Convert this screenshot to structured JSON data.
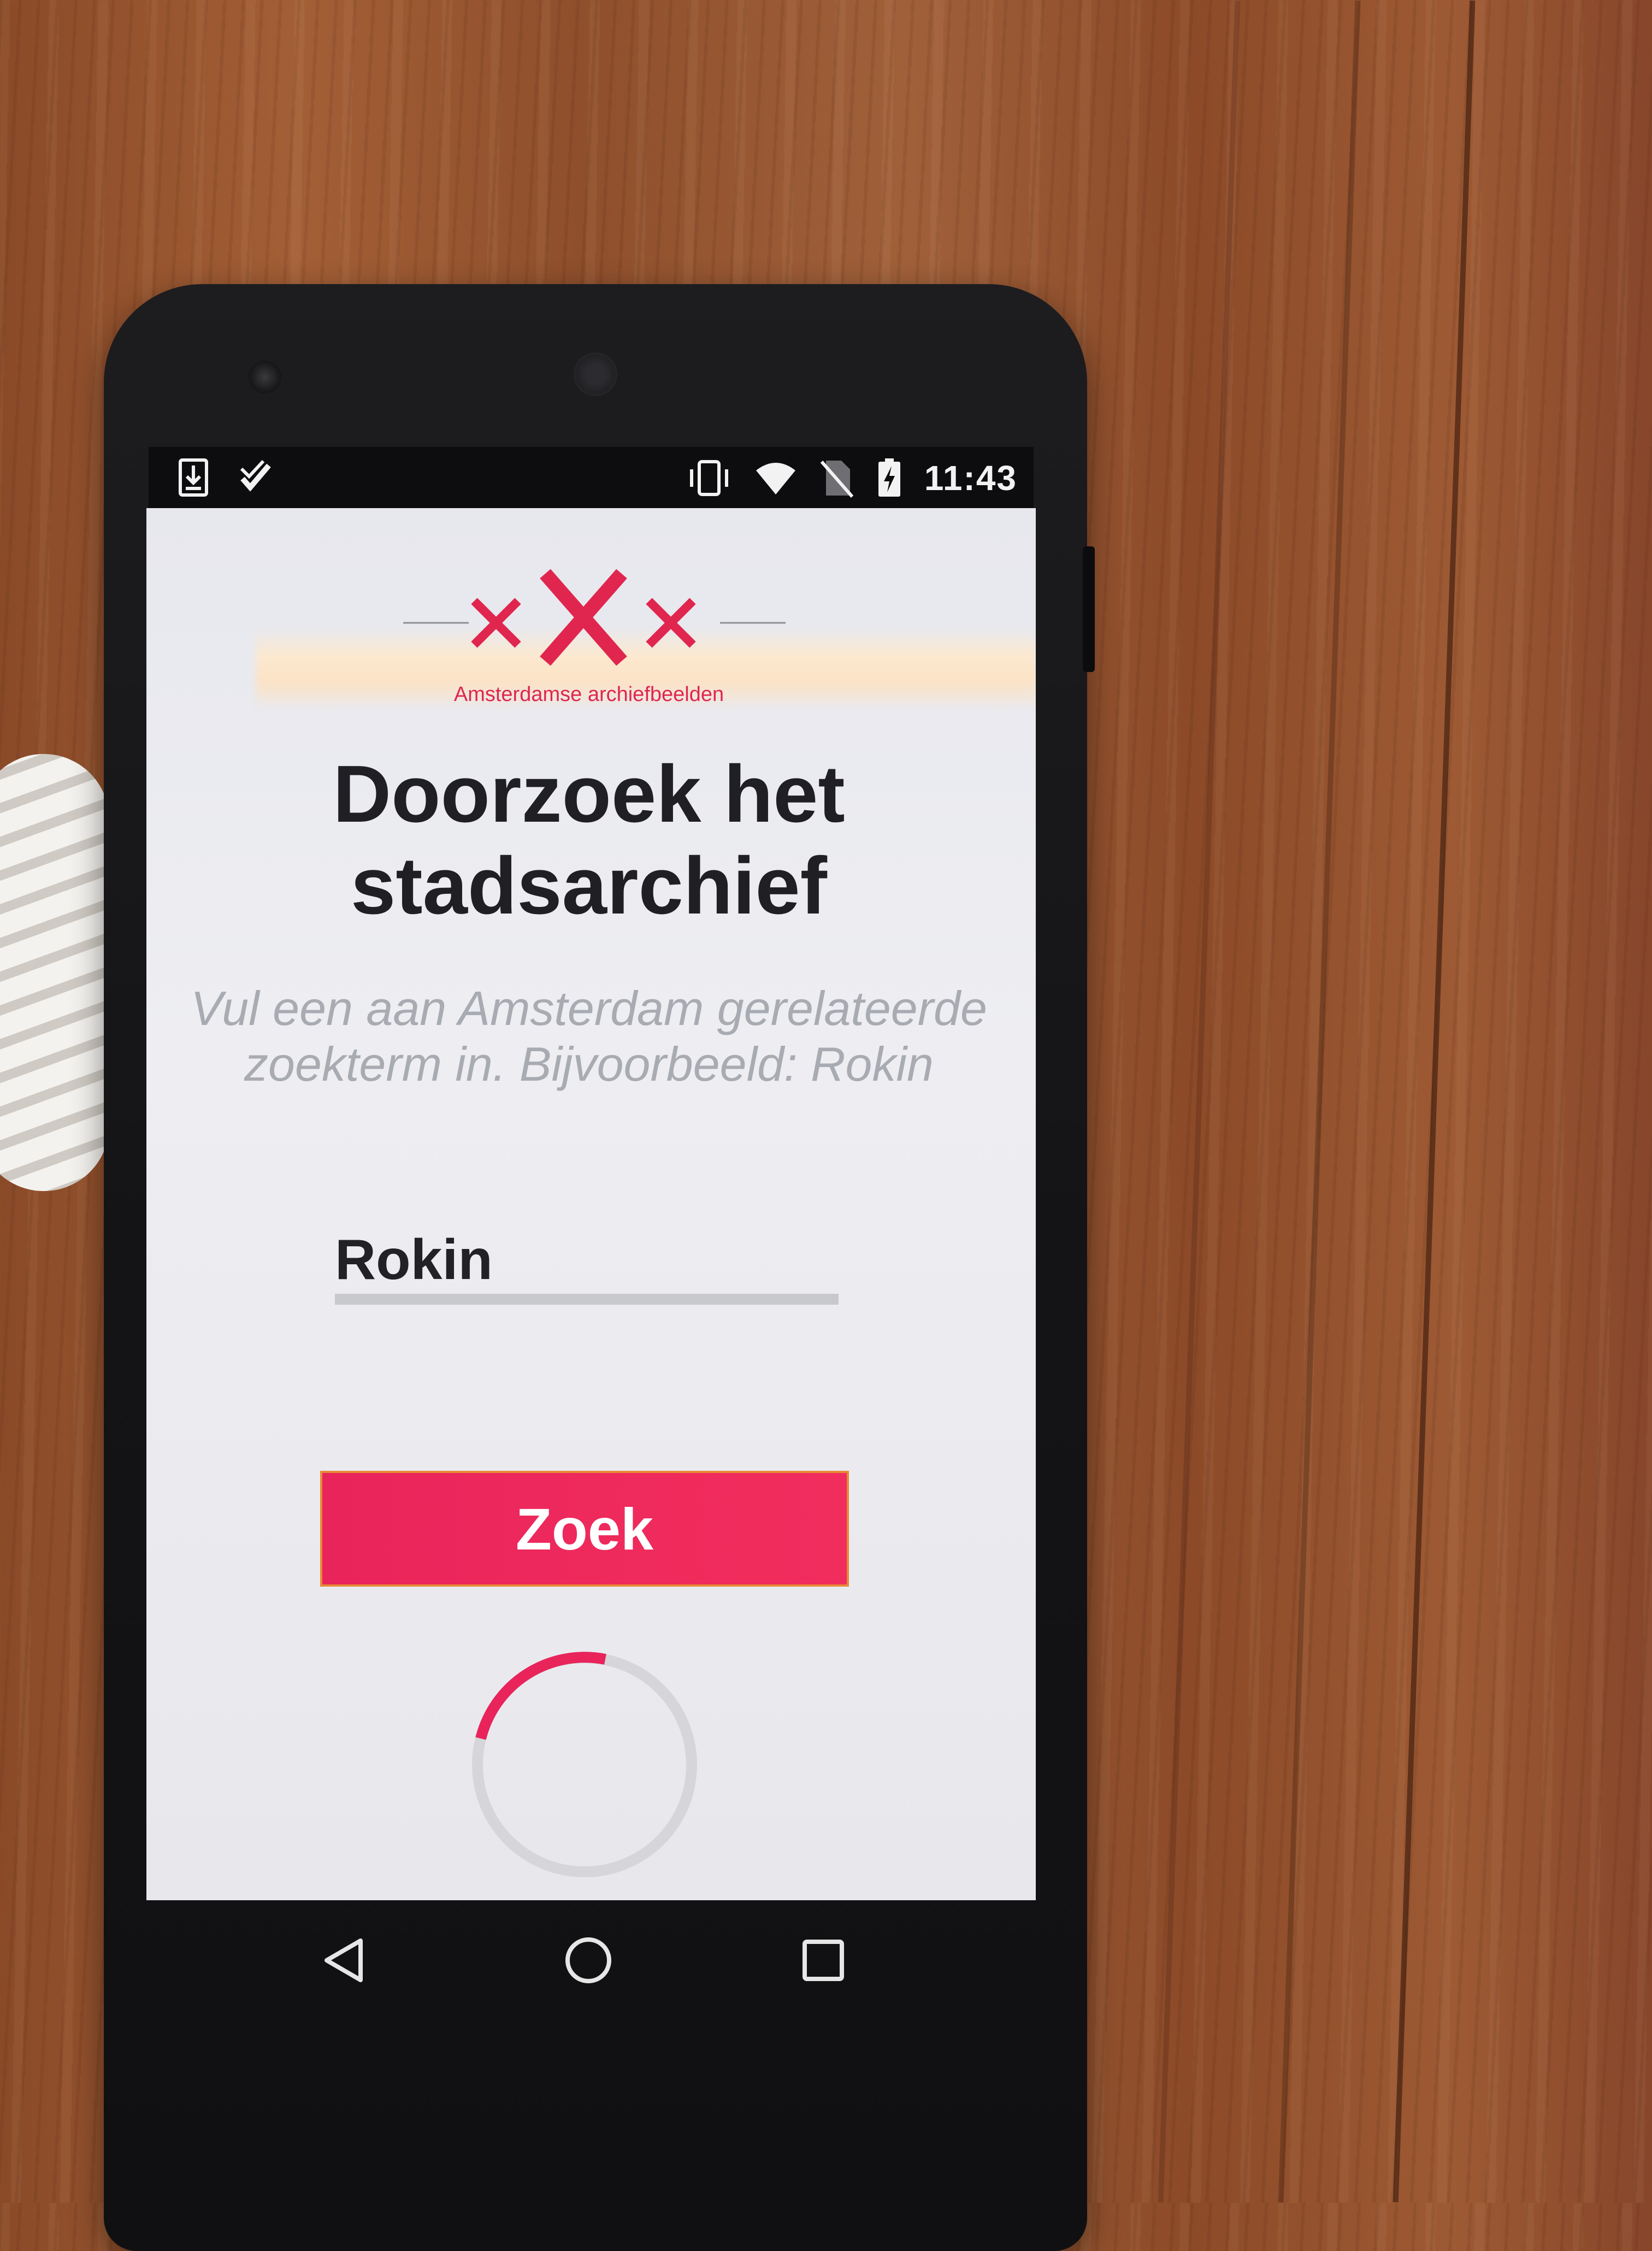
{
  "status_bar": {
    "time": "11:43",
    "left_icons": [
      "download-icon",
      "task-check-icon"
    ],
    "right_icons": [
      "vibrate-icon",
      "wifi-icon",
      "no-sim-icon",
      "battery-charging-icon"
    ]
  },
  "app": {
    "logo": {
      "caption": "Amsterdamse archiefbeelden",
      "mark": "three-crosses-icon",
      "color": "#e0264f"
    },
    "headline_line1": "Doorzoek het",
    "headline_line2": "stadsarchief",
    "subtitle_line1": "Vul een aan Amsterdam gerelateerde",
    "subtitle_line2": "zoekterm in. Bijvoorbeeld: Rokin",
    "search": {
      "value": "Rokin"
    },
    "search_button_label": "Zoek",
    "accent_color": "#ef2a5c",
    "loading_spinner": "progress-spinner"
  },
  "nav_bar": {
    "buttons": [
      "back-icon",
      "home-icon",
      "recents-icon"
    ]
  }
}
